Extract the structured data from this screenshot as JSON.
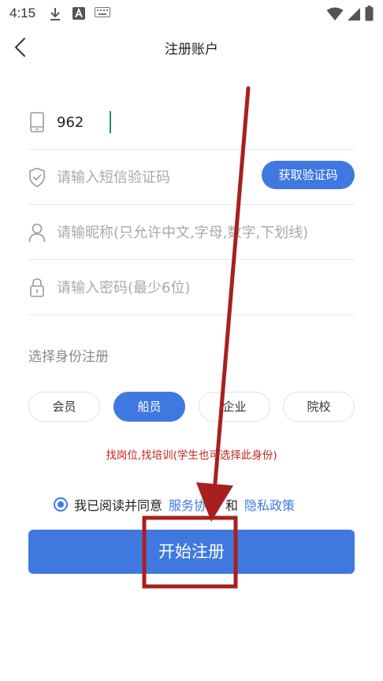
{
  "status_bar": {
    "time": "4:15",
    "icons": [
      "download-icon",
      "a-icon",
      "keyboard-icon",
      "wifi-icon",
      "signal-icon",
      "battery-icon"
    ]
  },
  "nav": {
    "title": "注册账户"
  },
  "form": {
    "phone_value": "962",
    "sms_code_placeholder": "请输入短信验证码",
    "get_code_label": "获取验证码",
    "nickname_placeholder": "请输昵称(只允许中文,字母,数字,下划线)",
    "password_placeholder": "请输入密码(最少6位)"
  },
  "roles": {
    "label": "选择身份注册",
    "options": [
      "会员",
      "船员",
      "企业",
      "院校"
    ],
    "selected": "船员",
    "hint": "找岗位,找培训(学生也可选择此身份)"
  },
  "agreement": {
    "prefix": "我已阅读并同意",
    "service_link": "服务协议",
    "joiner": "和",
    "privacy_link": "隐私政策"
  },
  "submit_label": "开始注册",
  "colors": {
    "primary": "#3f79e0",
    "hint_red": "#c3241e",
    "annotation_red": "#a8201e"
  }
}
